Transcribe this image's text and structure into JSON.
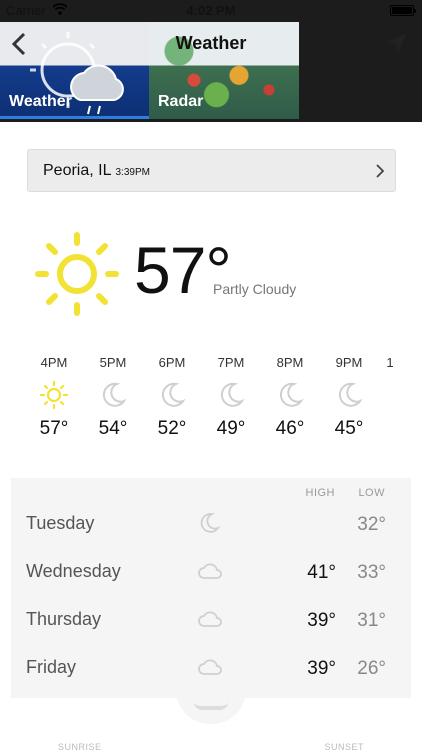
{
  "status_bar": {
    "carrier": "Carrier",
    "time": "4:02 PM"
  },
  "nav": {
    "title": "Weather"
  },
  "tabs": [
    {
      "label": "Weather",
      "selected": true
    },
    {
      "label": "Radar",
      "selected": false
    }
  ],
  "location": {
    "city": "Peoria, IL",
    "time": "3:39PM"
  },
  "current": {
    "temp": "57°",
    "condition": "Partly Cloudy",
    "icon": "sun-icon"
  },
  "hourly": [
    {
      "time": "4PM",
      "temp": "57°",
      "icon": "sun-icon"
    },
    {
      "time": "5PM",
      "temp": "54°",
      "icon": "moon-icon"
    },
    {
      "time": "6PM",
      "temp": "52°",
      "icon": "moon-icon"
    },
    {
      "time": "7PM",
      "temp": "49°",
      "icon": "moon-icon"
    },
    {
      "time": "8PM",
      "temp": "46°",
      "icon": "moon-icon"
    },
    {
      "time": "9PM",
      "temp": "45°",
      "icon": "moon-icon"
    },
    {
      "time": "1",
      "temp": "",
      "icon": ""
    }
  ],
  "daily": {
    "high_label": "HIGH",
    "low_label": "LOW",
    "days": [
      {
        "name": "Tuesday",
        "high": "",
        "low": "32°",
        "icon": "moon-icon"
      },
      {
        "name": "Wednesday",
        "high": "41°",
        "low": "33°",
        "icon": "cloud-icon"
      },
      {
        "name": "Thursday",
        "high": "39°",
        "low": "31°",
        "icon": "cloud-icon"
      },
      {
        "name": "Friday",
        "high": "39°",
        "low": "26°",
        "icon": "cloud-icon"
      }
    ]
  },
  "footer": {
    "left": "SUNRISE",
    "right": "SUNSET"
  },
  "colors": {
    "sun": "#f2e233",
    "accent": "#2f7de1",
    "icon_gray": "#cfcfcf"
  }
}
